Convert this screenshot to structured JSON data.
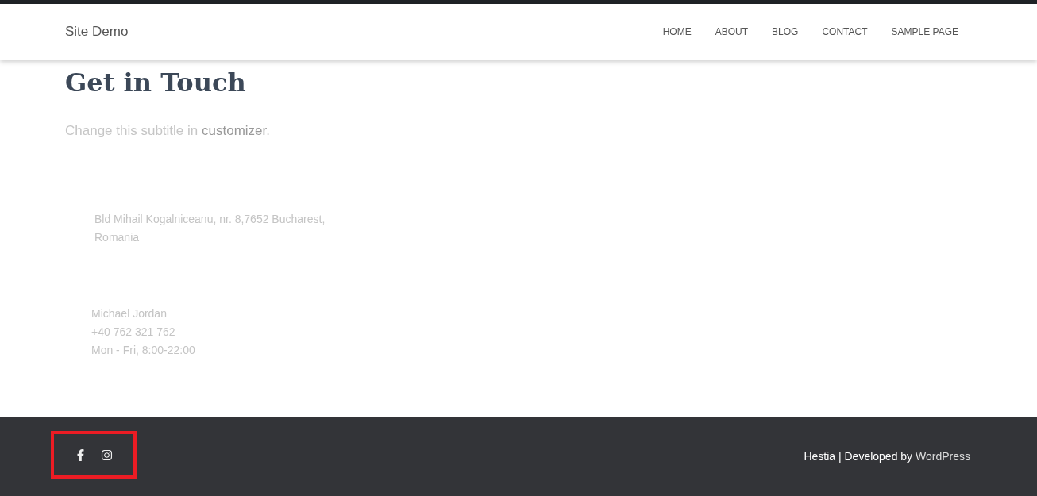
{
  "navbar": {
    "brand": "Site Demo",
    "items": [
      {
        "label": "HOME"
      },
      {
        "label": "ABOUT"
      },
      {
        "label": "BLOG"
      },
      {
        "label": "CONTACT"
      },
      {
        "label": "SAMPLE PAGE"
      }
    ]
  },
  "header": {
    "title": "Get in Touch",
    "subtitle_before": "Change this subtitle in ",
    "subtitle_link": "customizer",
    "subtitle_after": "."
  },
  "address": [
    "Bld Mihail Kogalniceanu, nr. 8,7652 Bucharest,",
    "Romania"
  ],
  "contact": [
    "Michael Jordan",
    "+40 762 321 762",
    "Mon - Fri, 8:00-22:00"
  ],
  "footer": {
    "social": [
      {
        "kind": "facebook"
      },
      {
        "kind": "instagram"
      }
    ],
    "highlighted": true,
    "credit_text": "Hestia | Developed by",
    "credit_link": "WordPress"
  }
}
